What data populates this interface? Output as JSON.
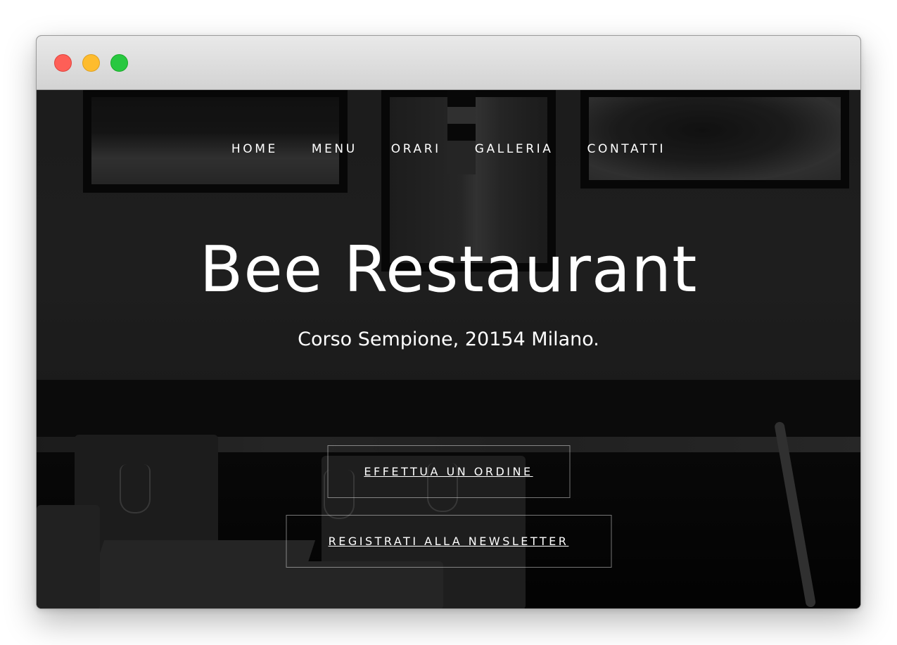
{
  "window": {
    "controls": [
      "close",
      "minimize",
      "maximize"
    ]
  },
  "nav": {
    "items": [
      {
        "label": "HOME"
      },
      {
        "label": "MENU"
      },
      {
        "label": "ORARI"
      },
      {
        "label": "GALLERIA"
      },
      {
        "label": "CONTATTI"
      }
    ]
  },
  "hero": {
    "title": "Bee Restaurant",
    "subtitle": "Corso Sempione, 20154 Milano.",
    "buttons": {
      "order": "EFFETTUA UN ORDINE",
      "newsletter": "REGISTRATI ALLA NEWSLETTER"
    }
  },
  "colors": {
    "text": "#ffffff",
    "overlay": "#000000",
    "close": "#fe5f57",
    "minimize": "#febc2e",
    "maximize": "#28c840"
  }
}
